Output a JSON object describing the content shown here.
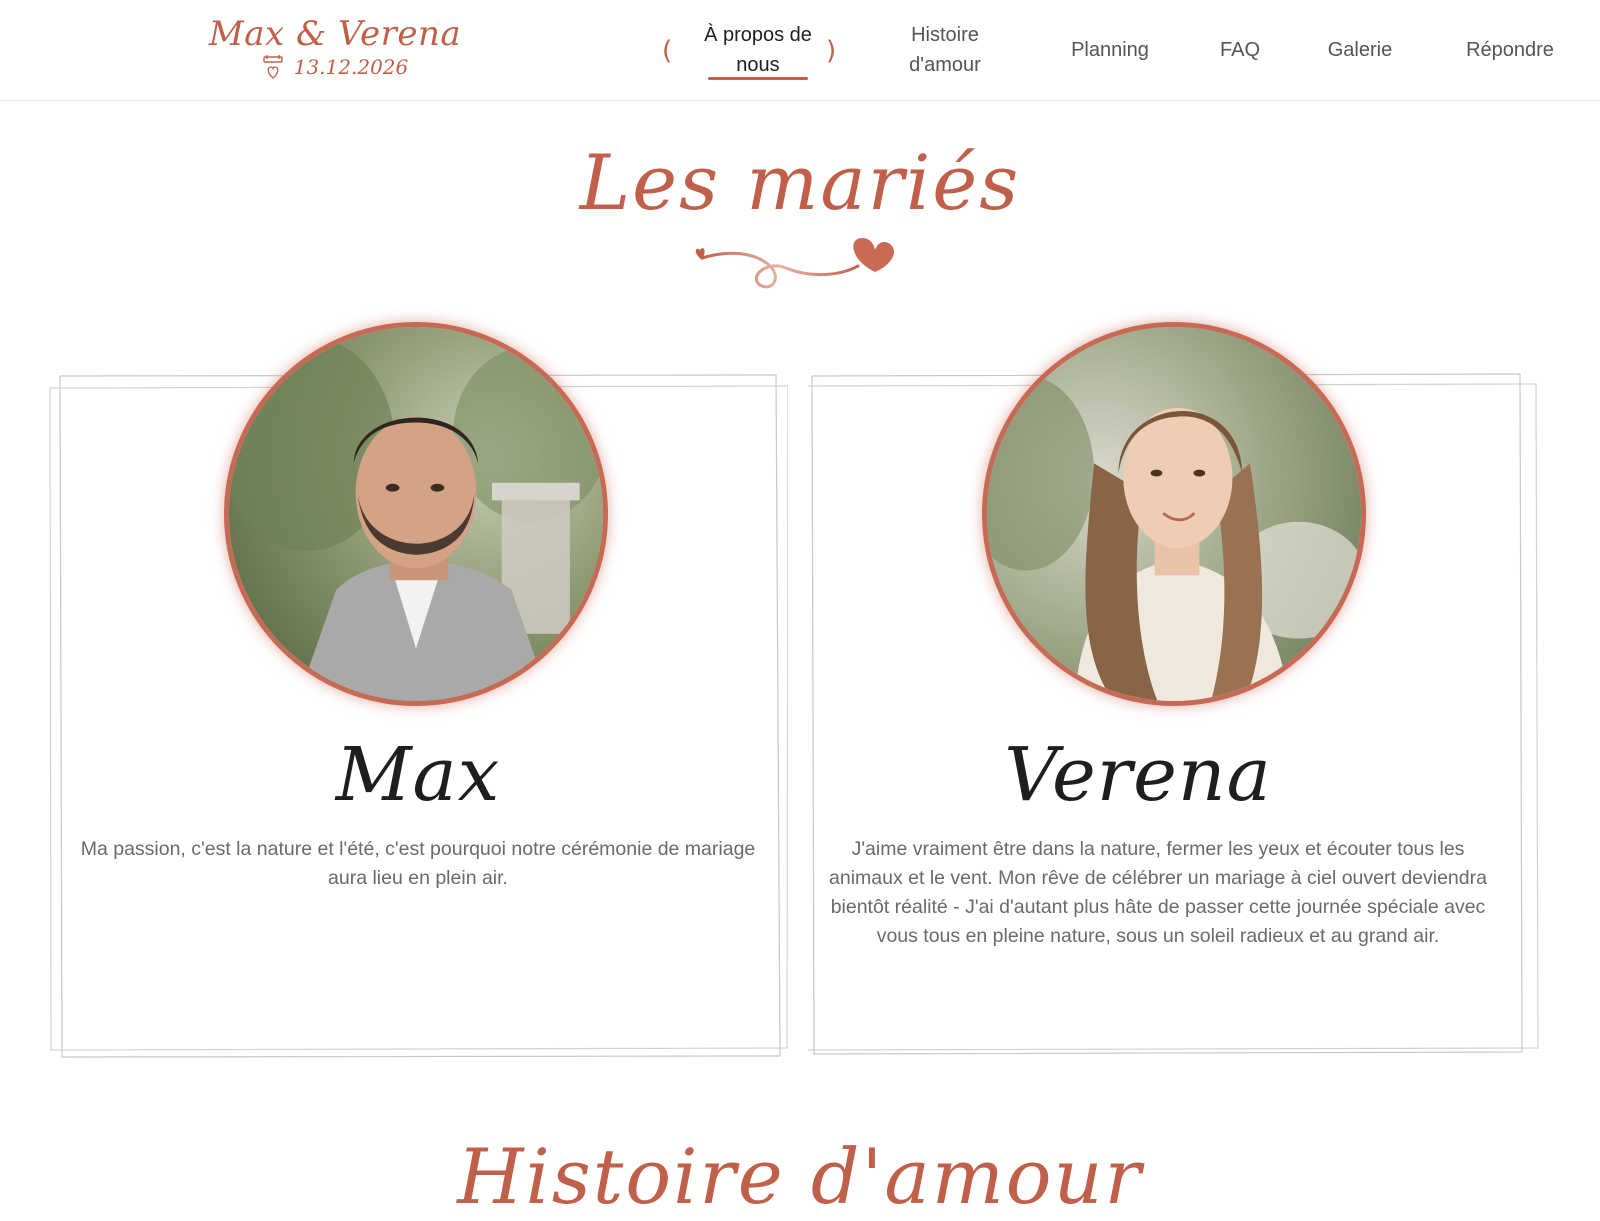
{
  "brand": {
    "names": "Max & Verena",
    "date": "13.12.2026",
    "calendar_icon": "calendar-heart-icon",
    "color": "#c0604a"
  },
  "nav": {
    "items": [
      {
        "label_line1": "À propos de",
        "label_line2": "nous",
        "active": true
      },
      {
        "label_line1": "Histoire",
        "label_line2": "d'amour",
        "active": false
      },
      {
        "label": "Planning",
        "active": false
      },
      {
        "label": "FAQ",
        "active": false
      },
      {
        "label": "Galerie",
        "active": false
      },
      {
        "label": "Répondre",
        "active": false
      }
    ],
    "accent": "#c0604a"
  },
  "section": {
    "title": "Les mariés",
    "ornament_icon": "heart-swirl-ornament"
  },
  "cards": [
    {
      "name": "Max",
      "bio": "Ma passion, c'est la nature et l'été, c'est pourquoi notre cérémonie de mariage aura lieu en plein air.",
      "photo": "groom-portrait"
    },
    {
      "name": "Verena",
      "bio": "J'aime vraiment être dans la nature, fermer les yeux et écouter tous les animaux et le vent. Mon rêve de célébrer un mariage à ciel ouvert deviendra bientôt réalité - J'ai d'autant plus hâte de passer cette journée spéciale avec vous tous en pleine nature, sous un soleil radieux et au grand air.",
      "photo": "bride-portrait"
    }
  ],
  "next_section": {
    "title": "Histoire d'amour"
  }
}
